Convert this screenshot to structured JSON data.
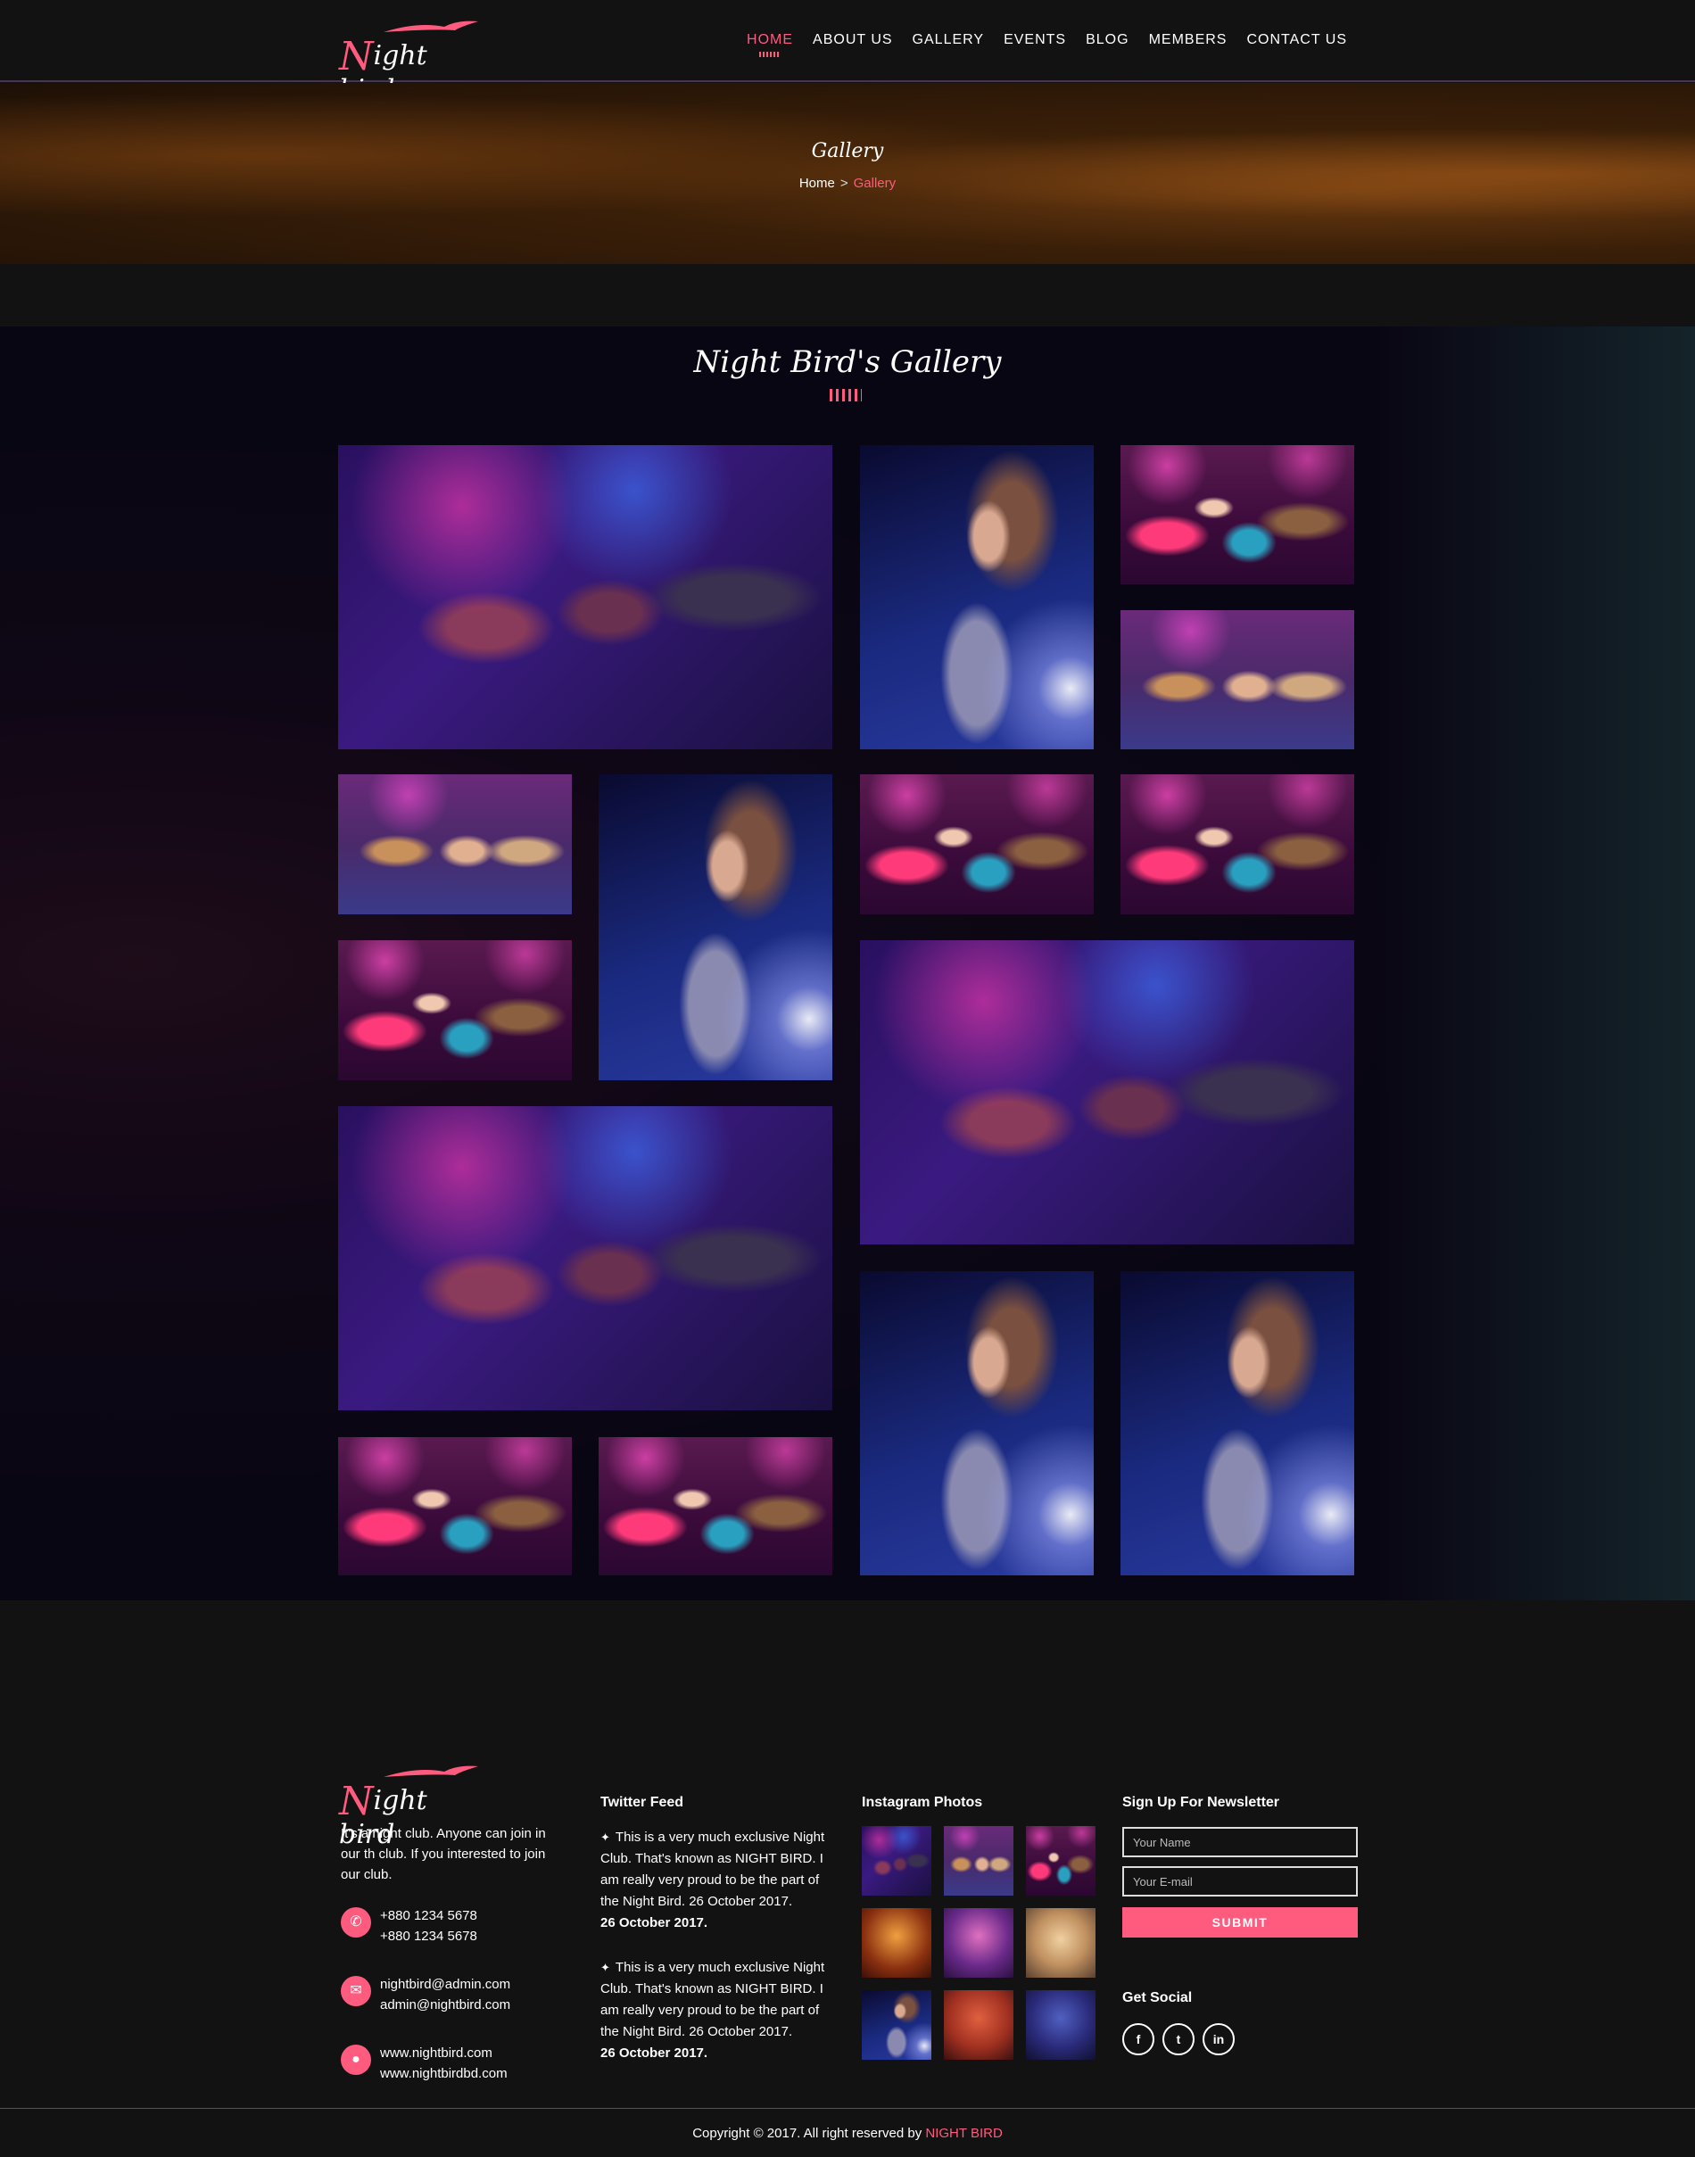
{
  "brand": {
    "logo_initial": "N",
    "logo_rest": "ight bird",
    "accent": "#ff5b7f"
  },
  "nav": {
    "items": [
      {
        "label": "HOME",
        "active": true
      },
      {
        "label": "ABOUT US"
      },
      {
        "label": "GALLERY"
      },
      {
        "label": "EVENTS"
      },
      {
        "label": "BLOG"
      },
      {
        "label": "MEMBERS"
      },
      {
        "label": "CONTACT US"
      }
    ]
  },
  "banner": {
    "title": "Gallery",
    "crumb_home": "Home",
    "crumb_sep": ">",
    "crumb_current": "Gallery"
  },
  "gallery": {
    "title": "Night Bird's Gallery"
  },
  "footer": {
    "about": "It's a night club. Anyone can join in our th club. If you interested to join our club.",
    "phone1": "+880 1234 5678",
    "phone2": "+880 1234 5678",
    "email1": "nightbird@admin.com",
    "email2": "admin@nightbird.com",
    "web1": "www.nightbird.com",
    "web2": "www.nightbirdbd.com",
    "twitter_title": "Twitter Feed",
    "tweets": [
      {
        "text": "This is a very much exclusive Night Club. That's known as NIGHT BIRD. I am really very proud to be the part of the Night Bird. 26 October 2017.",
        "date": "26 October 2017."
      },
      {
        "text": "This is a very much exclusive Night Club. That's known as NIGHT BIRD. I am really very proud to be the part of the Night Bird. 26 October 2017.",
        "date": "26 October 2017."
      }
    ],
    "instagram_title": "Instagram Photos",
    "newsletter_title": "Sign Up For Newsletter",
    "name_placeholder": "Your Name",
    "email_placeholder": "Your E-mail",
    "submit_label": "SUBMIT",
    "social_title": "Get Social",
    "social": [
      "f",
      "t",
      "in"
    ],
    "copyright_prefix": "Copyright © 2017. All right reserved by",
    "copyright_brand": "NIGHT BIRD"
  }
}
